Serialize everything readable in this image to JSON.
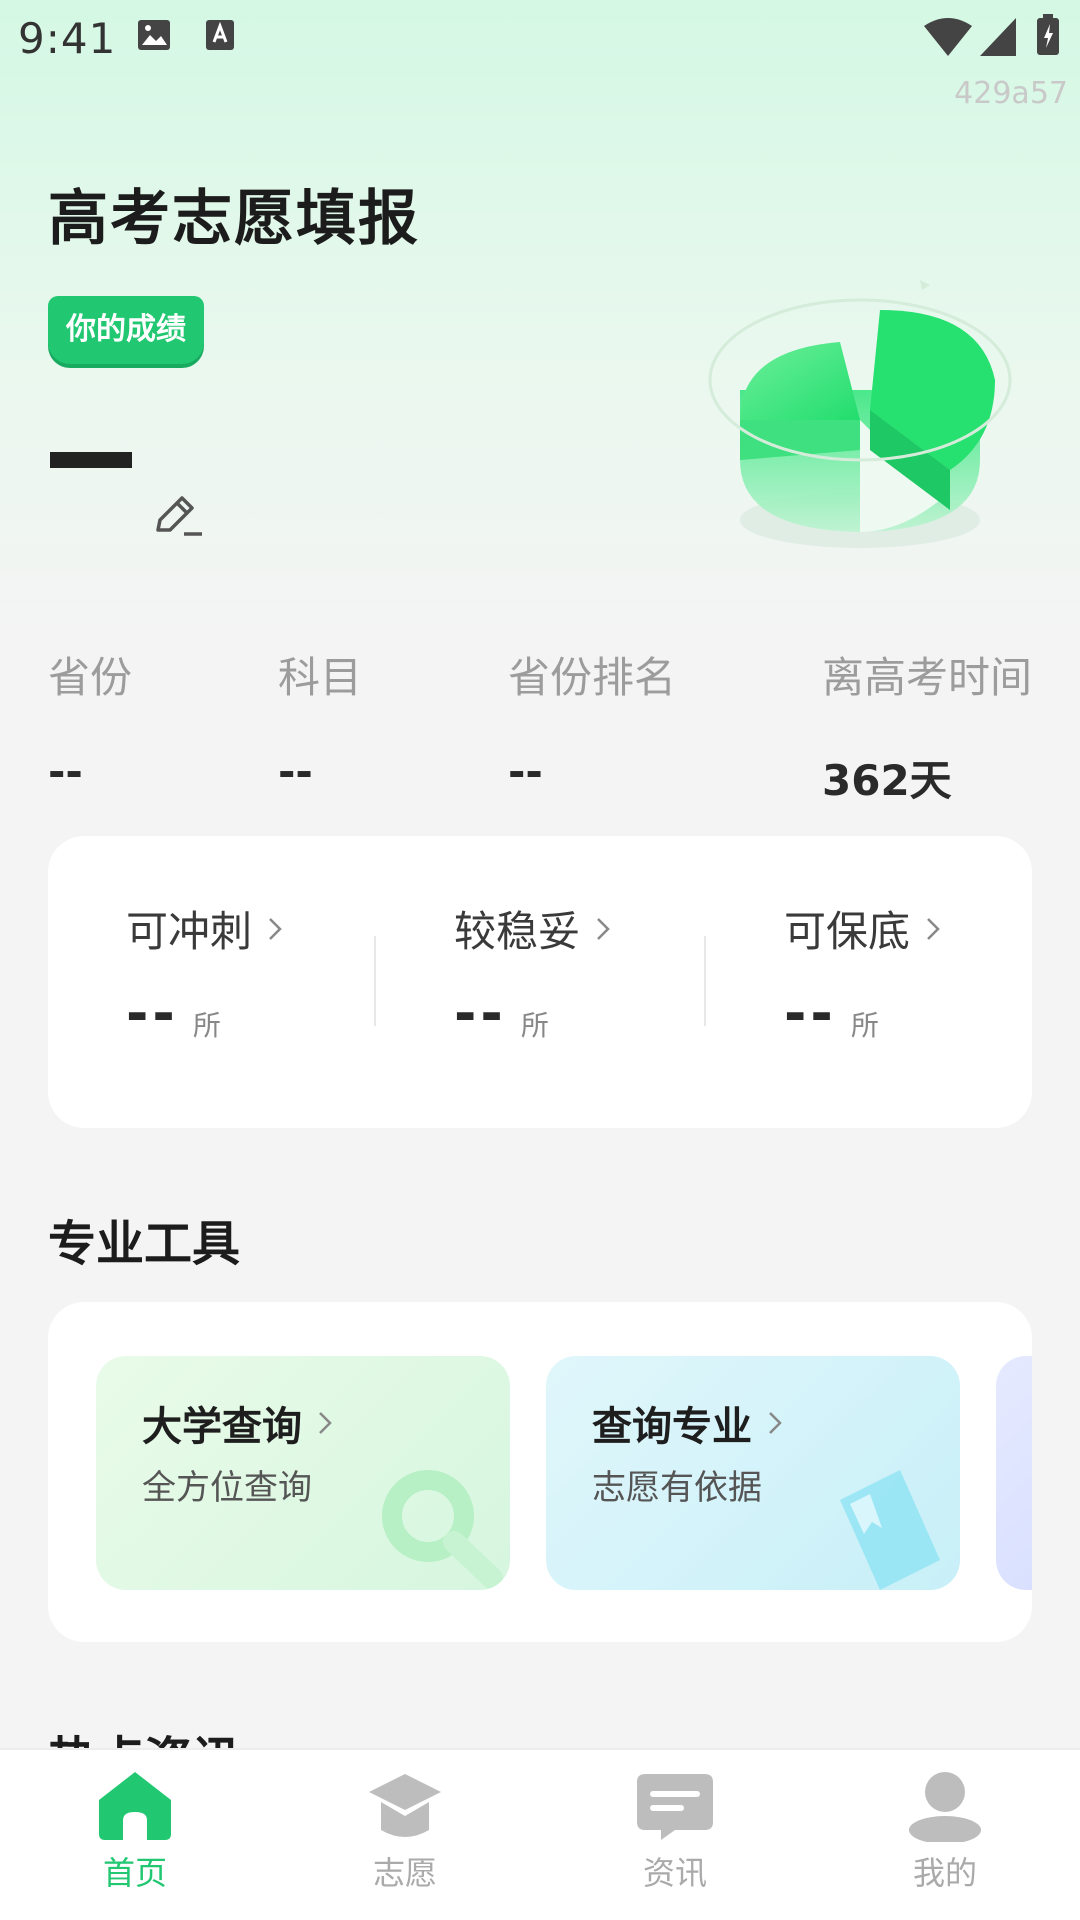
{
  "status_bar": {
    "time": "9:41"
  },
  "build_tag": "429a57",
  "hero": {
    "title": "高考志愿填报",
    "badge": "你的成绩",
    "score": "",
    "edit_icon": "pencil-icon"
  },
  "stats": [
    {
      "label": "省份",
      "value": "--"
    },
    {
      "label": "科目",
      "value": "--"
    },
    {
      "label": "省份排名",
      "value": "--"
    },
    {
      "label": "离高考时间",
      "value": "362天"
    }
  ],
  "recommend": [
    {
      "label": "可冲刺",
      "value": "--",
      "unit": "所"
    },
    {
      "label": "较稳妥",
      "value": "--",
      "unit": "所"
    },
    {
      "label": "可保底",
      "value": "--",
      "unit": "所"
    }
  ],
  "tools_section": {
    "title": "专业工具",
    "tools": [
      {
        "title": "大学查询",
        "subtitle": "全方位查询",
        "icon": "magnifier-icon"
      },
      {
        "title": "查询专业",
        "subtitle": "志愿有依据",
        "icon": "book-icon"
      }
    ]
  },
  "news_section": {
    "title": "热点资讯"
  },
  "bottom_nav": [
    {
      "label": "首页",
      "icon": "home-icon",
      "active": true
    },
    {
      "label": "志愿",
      "icon": "graduation-cap-icon",
      "active": false
    },
    {
      "label": "资讯",
      "icon": "message-icon",
      "active": false
    },
    {
      "label": "我的",
      "icon": "person-icon",
      "active": false
    }
  ],
  "colors": {
    "accent": "#21c771",
    "background": "#f4f4f4",
    "hero_gradient_top": "#d4f8e4"
  }
}
